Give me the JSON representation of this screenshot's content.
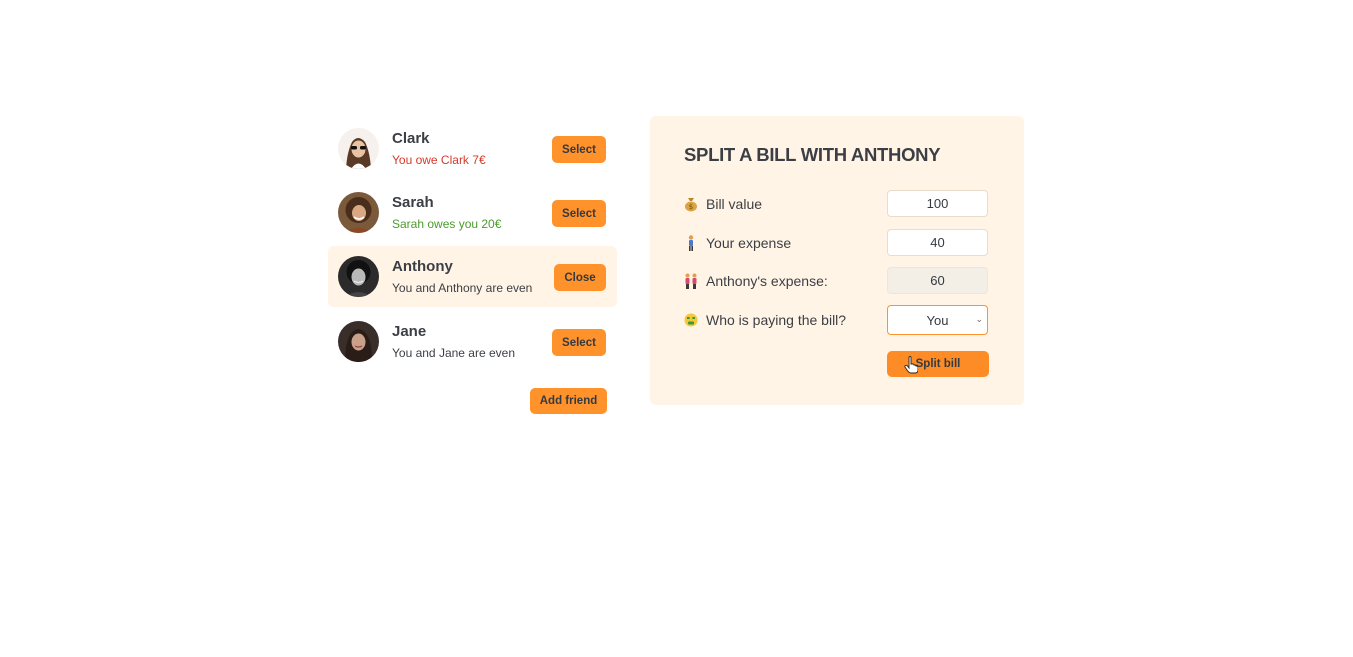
{
  "friends": [
    {
      "name": "Clark",
      "status": "You owe Clark 7€",
      "status_type": "red",
      "button": "Select",
      "selected": false
    },
    {
      "name": "Sarah",
      "status": "Sarah owes you 20€",
      "status_type": "green",
      "button": "Select",
      "selected": false
    },
    {
      "name": "Anthony",
      "status": "You and Anthony are even",
      "status_type": "neutral",
      "button": "Close",
      "selected": true
    },
    {
      "name": "Jane",
      "status": "You and Jane are even",
      "status_type": "neutral",
      "button": "Select",
      "selected": false
    }
  ],
  "add_friend_label": "Add friend",
  "split": {
    "title": "SPLIT A BILL WITH ANTHONY",
    "bill_value_label": "Bill value",
    "bill_value": "100",
    "your_expense_label": "Your expense",
    "your_expense": "40",
    "friend_expense_label": "Anthony's expense:",
    "friend_expense": "60",
    "payer_label": "Who is paying the bill?",
    "payer_value": "You",
    "split_button": "Split bill"
  },
  "colors": {
    "accent": "#ff922b",
    "panel": "#fff4e6",
    "owe_red": "#d63a2a",
    "owed_green": "#4b9c2d"
  },
  "icons": {
    "bill_value": "money-bag-icon",
    "your_expense": "person-standing-icon",
    "friend_expense": "two-people-icon",
    "payer": "money-mouth-face-icon"
  }
}
